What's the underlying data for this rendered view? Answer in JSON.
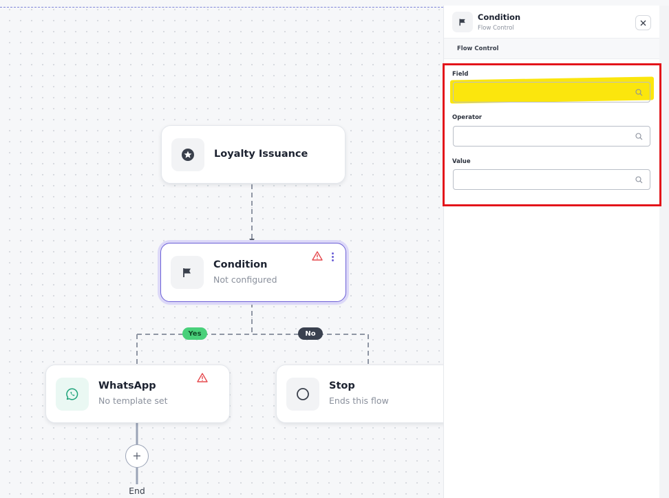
{
  "canvas": {
    "nodes": {
      "loyalty": {
        "title": "Loyalty Issuance",
        "icon": "star-badge-icon"
      },
      "condition": {
        "title": "Condition",
        "subtitle": "Not configured",
        "icon": "flag-icon",
        "warning_icon": "warning-icon",
        "menu_icon": "more-vertical-icon"
      },
      "whatsapp": {
        "title": "WhatsApp",
        "subtitle": "No template set",
        "icon": "whatsapp-icon",
        "warning_icon": "warning-icon"
      },
      "stop": {
        "title": "Stop",
        "subtitle": "Ends this flow",
        "icon": "circle-icon"
      }
    },
    "branches": {
      "yes": "Yes",
      "no": "No"
    },
    "add_button": "+",
    "end_label": "End"
  },
  "panel": {
    "title": "Condition",
    "subtitle": "Flow Control",
    "icon": "flag-icon",
    "close_icon": "close-icon",
    "section_tab": "Flow Control",
    "fields": [
      {
        "label": "Field",
        "value": "",
        "icon": "search-icon"
      },
      {
        "label": "Operator",
        "value": "",
        "icon": "search-icon"
      },
      {
        "label": "Value",
        "value": "",
        "icon": "search-icon"
      }
    ]
  },
  "colors": {
    "accent": "#6b5fd6",
    "yes": "#49d07a",
    "no": "#3a414f",
    "warning": "#e5484d",
    "highlight_box": "#e3141a",
    "highlight_marker": "#fbe500"
  }
}
